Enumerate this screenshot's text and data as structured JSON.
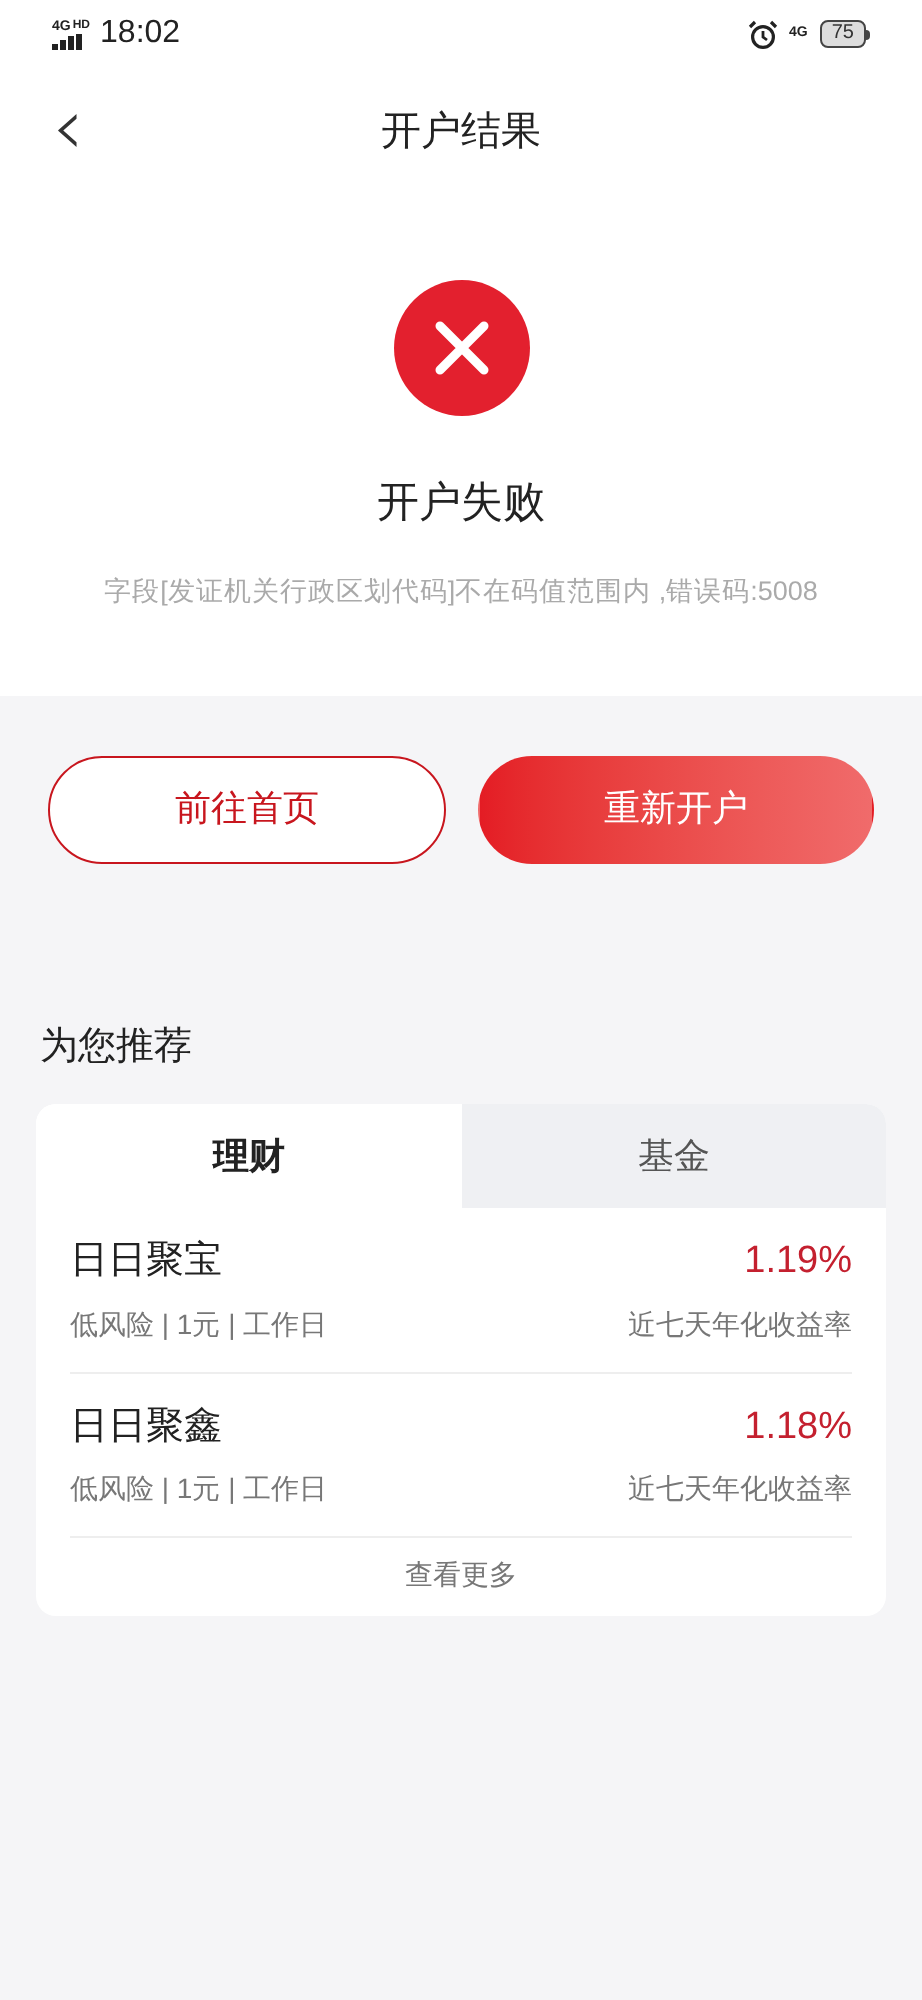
{
  "status_bar": {
    "network": "4G",
    "network_badge": "HD",
    "time": "18:02",
    "mobile": "4G",
    "battery": "75"
  },
  "header": {
    "back": "‹",
    "title": "开户结果"
  },
  "result": {
    "title": "开户失败",
    "message": "字段[发证机关行政区划代码]不在码值范围内 ,错误码:5008"
  },
  "buttons": [
    {
      "label": "前往首页",
      "kind": "outline"
    },
    {
      "label": "重新开户",
      "kind": "filled"
    }
  ],
  "recommend": {
    "title": "为您推荐",
    "tabs": [
      {
        "label": "理财",
        "selected": true
      },
      {
        "label": "基金",
        "selected": false
      }
    ],
    "products": [
      {
        "name": "日日聚宝",
        "tags": "低风险 | 1元 | 工作日",
        "rate": "1.19%",
        "rate_label": "近七天年化收益率"
      },
      {
        "name": "日日聚鑫",
        "tags": "低风险 | 1元 | 工作日",
        "rate": "1.18%",
        "rate_label": "近七天年化收益率"
      }
    ],
    "more": "查看更多"
  }
}
